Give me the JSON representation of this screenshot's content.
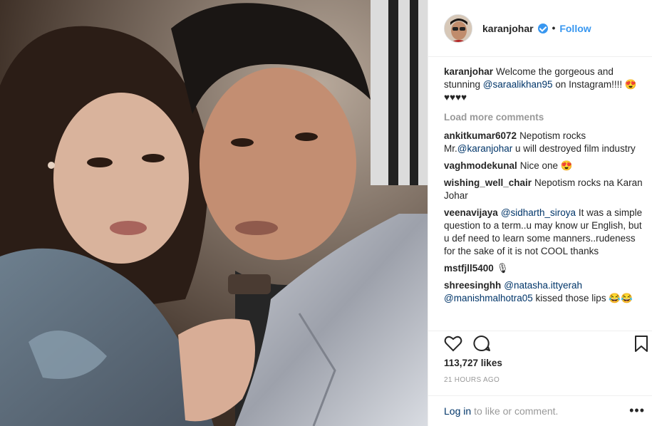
{
  "post": {
    "author": "karanjohar",
    "follow_label": "Follow",
    "dot": "•",
    "caption": {
      "user": "karanjohar",
      "text_before": "Welcome the gorgeous and stunning ",
      "mention": "@saraalikhan95",
      "text_after": " on Instagram!!!! 😍♥♥♥♥"
    },
    "load_more": "Load more comments",
    "comments": [
      {
        "user": "ankitkumar6072",
        "pre": "Nepotism rocks Mr.",
        "mention": "@karanjohar",
        "post": " u will destroyed film industry"
      },
      {
        "user": "vaghmodekunal",
        "pre": "Nice one 😍",
        "mention": "",
        "post": ""
      },
      {
        "user": "wishing_well_chair",
        "pre": "Nepotism rocks na Karan Johar",
        "mention": "",
        "post": ""
      },
      {
        "user": "veenavijaya",
        "pre": "",
        "mention": "@sidharth_siroya",
        "post": " It was a simple question to a term..u may know ur English, but u def need to learn some manners..rudeness for the sake of it is not COOL thanks"
      },
      {
        "user": "mstfjll5400",
        "pre": "🎙",
        "mention": "",
        "post": ""
      },
      {
        "user": "shreesinghh",
        "pre": "",
        "mention": "@natasha.ittyerah @manishmalhotra05",
        "post": " kissed those lips 😂😂"
      }
    ],
    "likes": "113,727 likes",
    "timestamp": "21 HOURS AGO",
    "login_label": "Log in",
    "login_suffix": "to like or comment.",
    "more_label": "•••"
  },
  "colors": {
    "accent": "#3897f0",
    "mention": "#003569",
    "muted": "#999999",
    "border": "#efefef"
  },
  "icons": [
    "verified-badge-icon",
    "heart-icon",
    "comment-icon",
    "bookmark-icon",
    "more-options-icon"
  ]
}
